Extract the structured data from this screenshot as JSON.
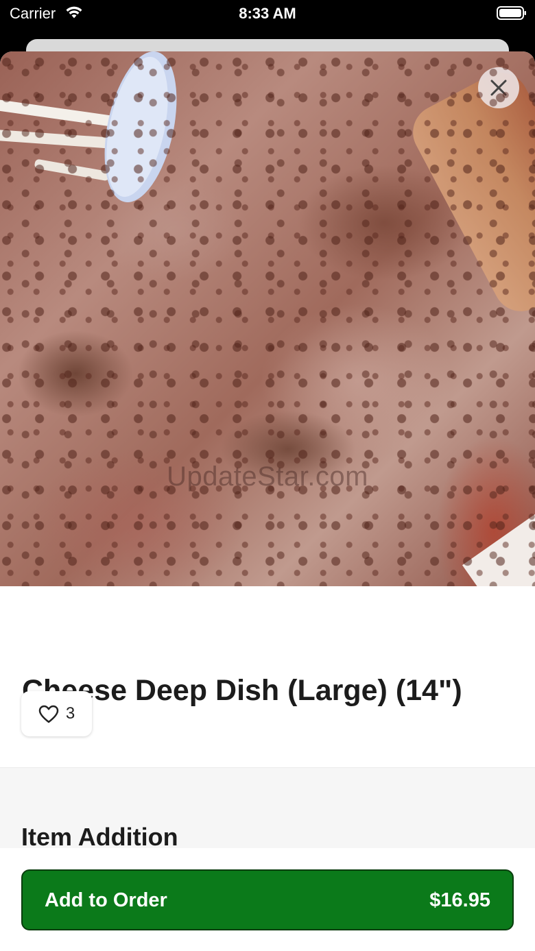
{
  "status_bar": {
    "carrier": "Carrier",
    "time": "8:33 AM",
    "icons": [
      "wifi-icon",
      "battery-icon"
    ]
  },
  "hero": {
    "watermark": "UpdateStar.com",
    "close_icon": "close-icon"
  },
  "item": {
    "title": "Cheese Deep Dish (Large) (14\")",
    "likes": "3",
    "like_icon": "heart-icon"
  },
  "section": {
    "title": "Item Addition"
  },
  "order_button": {
    "label": "Add to Order",
    "price": "$16.95",
    "color": "#0b7a1a"
  }
}
